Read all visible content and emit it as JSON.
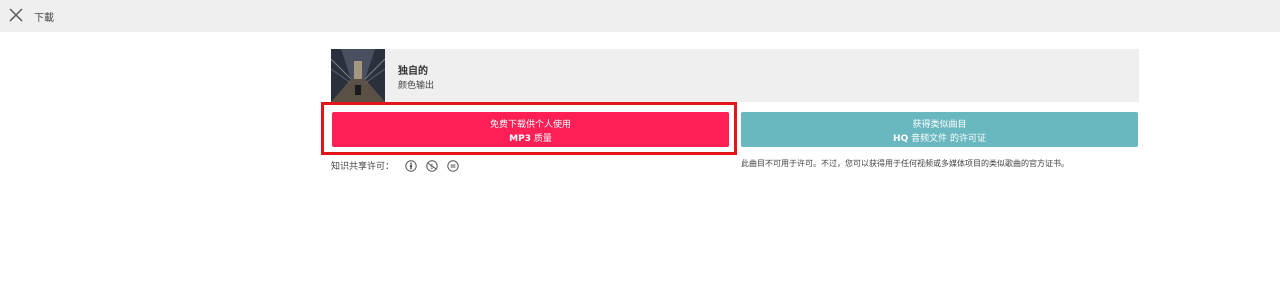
{
  "header": {
    "title": "下載",
    "close_icon": "close-icon"
  },
  "track": {
    "title": "独自的",
    "artist": "颜色输出"
  },
  "actions": {
    "free_download": {
      "line1": "免费下载供个人使用",
      "line2_bold": "MP3",
      "line2_rest": " 质量",
      "color": "#ff1f57"
    },
    "license": {
      "line1": "获得类似曲目",
      "line2_bold": "HQ",
      "line2_rest": " 音频文件 的许可证",
      "color": "#69b7bf"
    }
  },
  "creative_commons": {
    "label": "知识共享许可：",
    "icons": [
      "cc-by-icon",
      "cc-nc-icon",
      "cc-nd-icon"
    ]
  },
  "license_note": "此曲目不可用于许可。不过，您可以获得用于任何视频或多媒体项目的类似歌曲的官方证书。",
  "colors": {
    "highlight_border": "#e3151a",
    "topbar_bg": "#efefef"
  }
}
